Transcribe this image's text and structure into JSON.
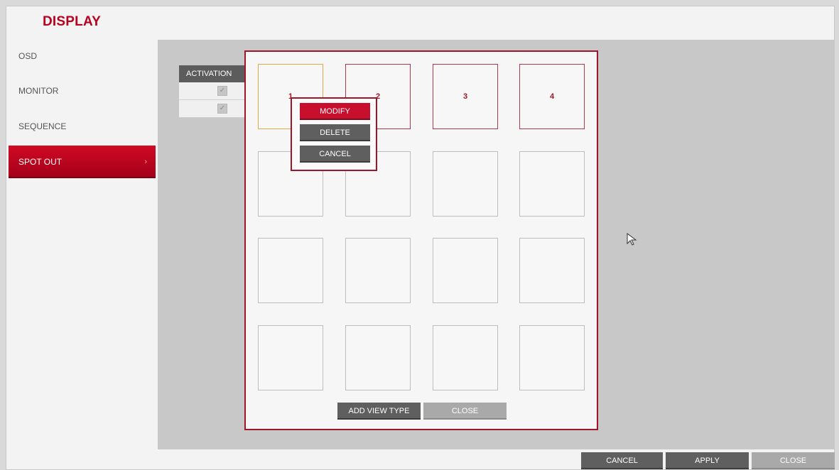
{
  "window": {
    "title": "DISPLAY"
  },
  "sidebar": {
    "items": [
      {
        "label": "OSD"
      },
      {
        "label": "MONITOR"
      },
      {
        "label": "SEQUENCE"
      },
      {
        "label": "SPOT OUT",
        "active": true,
        "chevron": "›"
      }
    ]
  },
  "activation_table": {
    "header": "ACTIVATION",
    "rows": [
      {
        "checked": true
      },
      {
        "checked": true
      }
    ]
  },
  "dialog": {
    "grid_cells": [
      "1",
      "2",
      "3",
      "4",
      "",
      "",
      "",
      "",
      "",
      "",
      "",
      "",
      "",
      "",
      "",
      ""
    ],
    "add_view_type_label": "ADD VIEW TYPE",
    "close_label": "CLOSE"
  },
  "context_menu": {
    "modify_label": "MODIFY",
    "delete_label": "DELETE",
    "cancel_label": "CANCEL"
  },
  "footer": {
    "cancel_label": "CANCEL",
    "apply_label": "APPLY",
    "close_label": "CLOSE"
  },
  "colors": {
    "accent": "#b8001f",
    "dialog_border": "#a01528",
    "button_dark": "#5f5f5f",
    "button_light": "#a9a9a9"
  },
  "icons": {
    "checkbox": "check-icon",
    "cursor": "mouse-pointer-icon"
  }
}
